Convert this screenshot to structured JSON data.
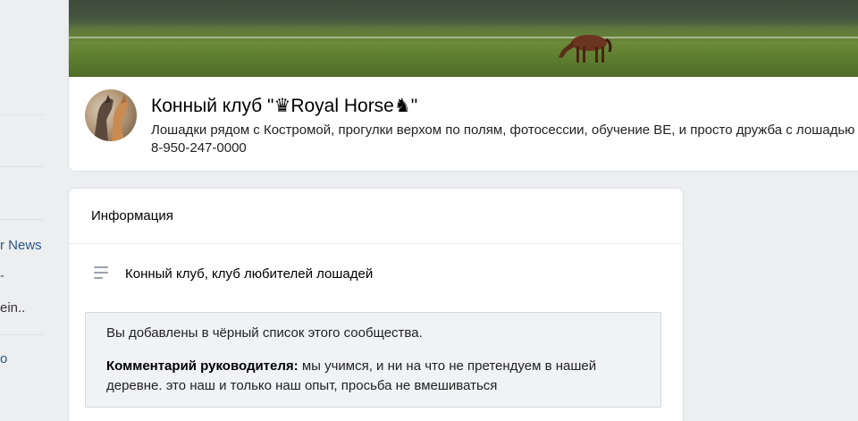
{
  "sidebar": {
    "items": [
      {
        "label": "r News"
      },
      {
        "label": "-"
      },
      {
        "label": "ein.."
      },
      {
        "label": "o"
      }
    ]
  },
  "club": {
    "title": "Конный клуб \"♛Royal Horse♞\"",
    "description": "Лошадки рядом с Костромой, прогулки верхом по полям, фотосессии, обучение ВЕ, и просто дружба с лошадью 8-950-247-0000"
  },
  "info": {
    "heading": "Информация",
    "category": "Конный клуб, клуб любителей лошадей",
    "notice": {
      "message": "Вы добавлены в чёрный список этого сообщества.",
      "comment_label": "Комментарий руководителя:",
      "comment_text": " мы учимся, и ни на что не претендуем в нашей деревне. это наш и только наш опыт, просьба не вмешиваться"
    }
  },
  "colors": {
    "background": "#edeef0",
    "link": "#2a5885",
    "notice_bg": "#f0f2f5"
  },
  "icons": {
    "category": "lines-icon"
  }
}
